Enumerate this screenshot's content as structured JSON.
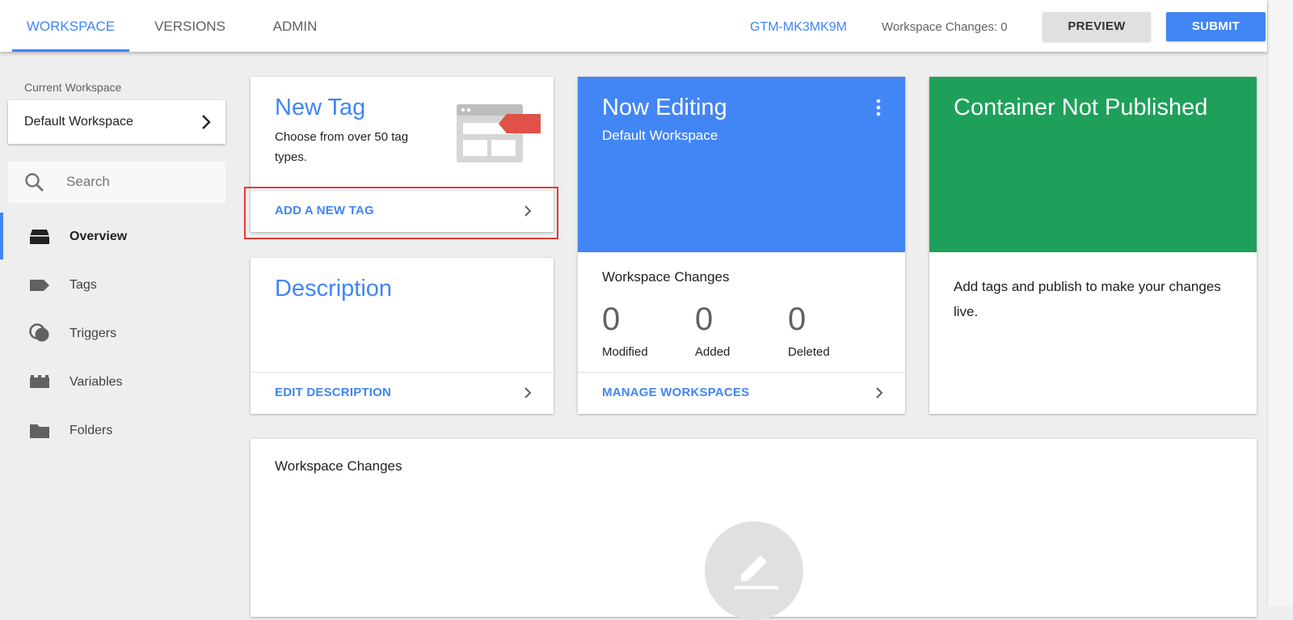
{
  "topbar": {
    "tabs": [
      {
        "label": "WORKSPACE",
        "active": true
      },
      {
        "label": "VERSIONS",
        "active": false
      },
      {
        "label": "ADMIN",
        "active": false
      }
    ],
    "container_id": "GTM-MK3MK9M",
    "workspace_changes": "Workspace Changes: 0",
    "preview_label": "PREVIEW",
    "submit_label": "SUBMIT"
  },
  "sidebar": {
    "current_workspace_label": "Current Workspace",
    "current_workspace": "Default Workspace",
    "search_placeholder": "Search",
    "items": [
      {
        "label": "Overview",
        "icon": "overview-icon",
        "active": true
      },
      {
        "label": "Tags",
        "icon": "tag-icon",
        "active": false
      },
      {
        "label": "Triggers",
        "icon": "trigger-icon",
        "active": false
      },
      {
        "label": "Variables",
        "icon": "variable-icon",
        "active": false
      },
      {
        "label": "Folders",
        "icon": "folder-icon",
        "active": false
      }
    ]
  },
  "new_tag": {
    "title": "New Tag",
    "subtitle": "Choose from over 50 tag types.",
    "link": "ADD A NEW TAG"
  },
  "description": {
    "title": "Description",
    "link": "EDIT DESCRIPTION"
  },
  "now_editing": {
    "title": "Now Editing",
    "workspace": "Default Workspace",
    "changes_title": "Workspace Changes",
    "stats": [
      {
        "value": "0",
        "label": "Modified"
      },
      {
        "value": "0",
        "label": "Added"
      },
      {
        "value": "0",
        "label": "Deleted"
      }
    ],
    "link": "MANAGE WORKSPACES"
  },
  "container_status": {
    "title": "Container Not Published",
    "body": "Add tags and publish to make your changes live."
  },
  "workspace_changes_card": {
    "title": "Workspace Changes"
  },
  "colors": {
    "accent": "#4285f4",
    "published_green": "#1fa05a",
    "highlight_red": "#e53935"
  }
}
